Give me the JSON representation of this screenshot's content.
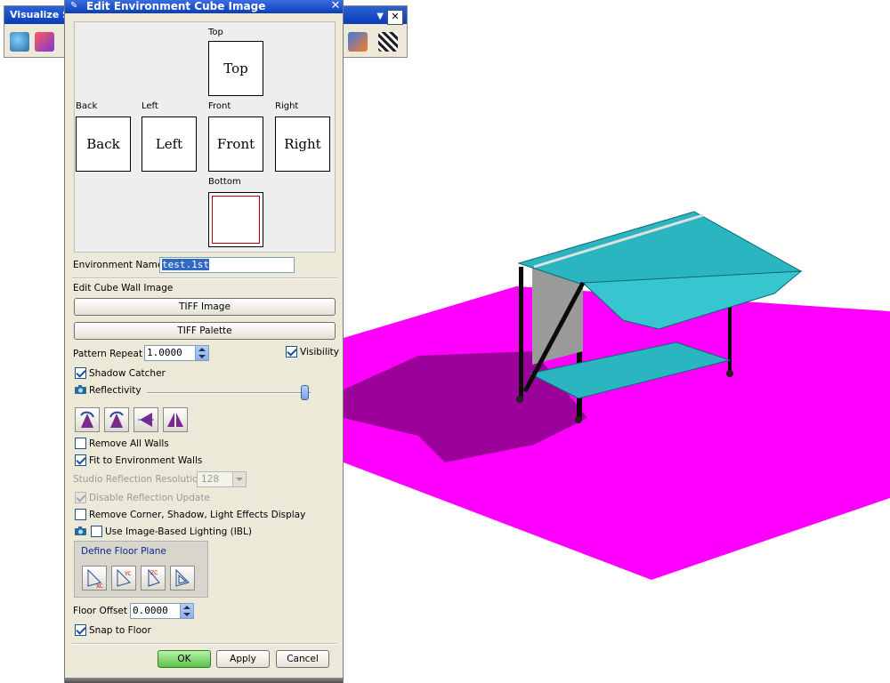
{
  "background_window": {
    "title": "Visualize Sh",
    "close_glyph": "✕"
  },
  "dialog": {
    "title": "Edit Environment Cube Image",
    "close_glyph": "✕",
    "cube_faces": {
      "top": {
        "label": "Top",
        "text": "Top"
      },
      "back": {
        "label": "Back",
        "text": "Back"
      },
      "left": {
        "label": "Left",
        "text": "Left"
      },
      "front": {
        "label": "Front",
        "text": "Front"
      },
      "right": {
        "label": "Right",
        "text": "Right"
      },
      "bottom": {
        "label": "Bottom",
        "text": ""
      }
    },
    "environment_name": {
      "label": "Environment Name",
      "value": "test.1st"
    },
    "edit_cube_wall_image": {
      "label": "Edit Cube Wall Image",
      "tiff_image_button": "TIFF Image",
      "tiff_palette_button": "TIFF Palette"
    },
    "pattern_repeat": {
      "label": "Pattern Repeat",
      "value": "1.0000"
    },
    "visibility": {
      "label": "Visibility",
      "checked": true
    },
    "shadow_catcher": {
      "label": "Shadow Catcher",
      "checked": true
    },
    "reflectivity": {
      "label": "Reflectivity",
      "level": 1.0
    },
    "wall_tools": [
      "rotate-left",
      "rotate-right",
      "flip-horizontal",
      "mirror"
    ],
    "remove_all_walls": {
      "label": "Remove All Walls",
      "checked": false
    },
    "fit_to_environment_walls": {
      "label": "Fit to Environment Walls",
      "checked": true
    },
    "studio_reflection_resolution": {
      "label": "Studio Reflection Resolution",
      "value": "128"
    },
    "disable_reflection_update": {
      "label": "Disable Reflection Update",
      "checked": true
    },
    "remove_corner_shadow": {
      "label": "Remove Corner, Shadow, Light Effects Display",
      "checked": false
    },
    "use_ibl": {
      "label": "Use Image-Based Lighting (IBL)",
      "checked": false
    },
    "define_floor_plane": {
      "label": "Define Floor Plane",
      "tools": [
        "XC",
        "YC",
        "ZC",
        "plane"
      ]
    },
    "floor_offset": {
      "label": "Floor Offset",
      "value": "0.0000"
    },
    "snap_to_floor": {
      "label": "Snap to Floor",
      "checked": true
    },
    "buttons": {
      "ok": "OK",
      "apply": "Apply",
      "cancel": "Cancel"
    }
  },
  "colors": {
    "floor": "#ff00ff",
    "table": "#2bb5c0",
    "title_bar": "#0b3fb9"
  }
}
